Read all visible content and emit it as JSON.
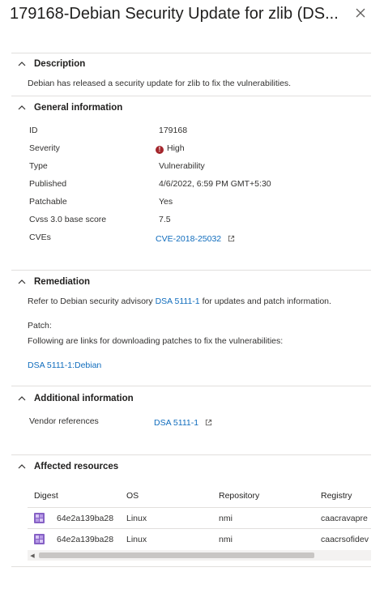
{
  "panel": {
    "title": "179168-Debian Security Update for zlib (DS...",
    "close_icon": "close-icon"
  },
  "description": {
    "heading": "Description",
    "text": "Debian has released a security update for zlib to fix the vulnerabilities."
  },
  "general": {
    "heading": "General information",
    "properties": [
      {
        "label": "ID",
        "value": "179168"
      },
      {
        "label": "Severity",
        "value": "High"
      },
      {
        "label": "Type",
        "value": "Vulnerability"
      },
      {
        "label": "Published",
        "value": "4/6/2022, 6:59 PM GMT+5:30"
      },
      {
        "label": "Patchable",
        "value": "Yes"
      },
      {
        "label": "Cvss 3.0 base score",
        "value": "7.5"
      },
      {
        "label": "CVEs",
        "value": "CVE-2018-25032"
      }
    ],
    "severity_color": "#a4262c"
  },
  "remediation": {
    "heading": "Remediation",
    "text_before": "Refer to Debian security advisory",
    "advisory_link": "DSA 5111-1",
    "text_after": "for updates and patch information.",
    "patch_label": "Patch:",
    "patch_text": "Following are links for downloading patches to fix the vulnerabilities:",
    "patch_link": "DSA 5111-1:Debian"
  },
  "additional": {
    "heading": "Additional information",
    "vendor_label": "Vendor references",
    "vendor_link": "DSA 5111-1"
  },
  "affected": {
    "heading": "Affected resources",
    "columns": [
      "Digest",
      "OS",
      "Repository",
      "Registry"
    ],
    "rows": [
      {
        "digest": "64e2a139ba28",
        "os": "Linux",
        "repository": "nmi",
        "registry": "caacravapre"
      },
      {
        "digest": "64e2a139ba28",
        "os": "Linux",
        "repository": "nmi",
        "registry": "caacrsofidev"
      }
    ]
  },
  "colors": {
    "link": "#0f6cbd",
    "divider": "#e1dfdd",
    "registry_icon": "#8661c5"
  }
}
